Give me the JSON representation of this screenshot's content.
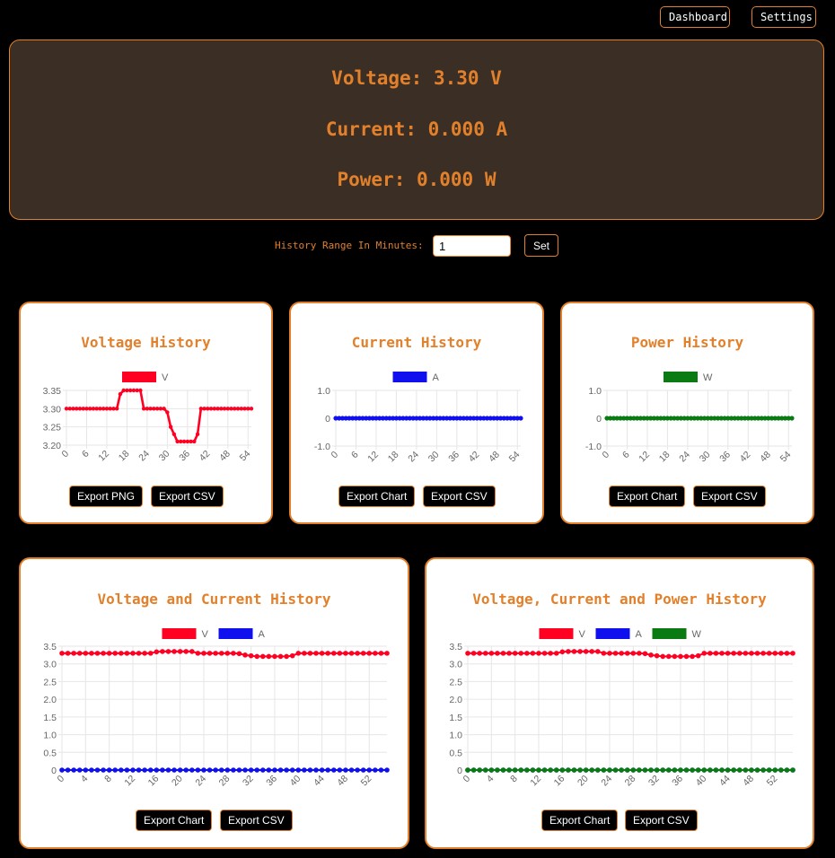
{
  "nav": {
    "dashboard": "Dashboard",
    "settings": "Settings"
  },
  "readout": {
    "voltage": "Voltage: 3.30 V",
    "current": "Current: 0.000 A",
    "power": "Power: 0.000 W"
  },
  "history": {
    "label": "History Range In Minutes:",
    "value": "1",
    "set_label": "Set"
  },
  "colors": {
    "accent": "#e2802b",
    "voltage": "#ff0022",
    "current": "#1010ee",
    "power": "#0a7a12",
    "panel": "#3b2e24"
  },
  "cards": {
    "voltage": {
      "title": "Voltage History",
      "export1": "Export PNG",
      "export2": "Export CSV"
    },
    "current": {
      "title": "Current History",
      "export1": "Export Chart",
      "export2": "Export CSV"
    },
    "power": {
      "title": "Power History",
      "export1": "Export Chart",
      "export2": "Export CSV"
    },
    "vc": {
      "title": "Voltage and Current History",
      "export1": "Export Chart",
      "export2": "Export CSV"
    },
    "vcp": {
      "title": "Voltage, Current and Power History",
      "export1": "Export Chart",
      "export2": "Export CSV"
    }
  },
  "chart_data": [
    {
      "id": "voltage",
      "type": "line",
      "x_ticks": [
        "0",
        "6",
        "12",
        "18",
        "24",
        "30",
        "36",
        "42",
        "48",
        "54"
      ],
      "y_ticks": [
        "3.35",
        "3.30",
        "3.25",
        "3.20"
      ],
      "ylim": [
        3.2,
        3.35
      ],
      "xlim": [
        0,
        55
      ],
      "series": [
        {
          "name": "V",
          "color": "#ff0022",
          "values": [
            3.3,
            3.3,
            3.3,
            3.3,
            3.3,
            3.3,
            3.3,
            3.3,
            3.3,
            3.3,
            3.3,
            3.3,
            3.3,
            3.3,
            3.3,
            3.3,
            3.34,
            3.35,
            3.35,
            3.35,
            3.35,
            3.35,
            3.35,
            3.3,
            3.3,
            3.3,
            3.3,
            3.3,
            3.3,
            3.3,
            3.29,
            3.25,
            3.23,
            3.21,
            3.21,
            3.21,
            3.21,
            3.21,
            3.21,
            3.23,
            3.3,
            3.3,
            3.3,
            3.3,
            3.3,
            3.3,
            3.3,
            3.3,
            3.3,
            3.3,
            3.3,
            3.3,
            3.3,
            3.3,
            3.3,
            3.3
          ]
        }
      ]
    },
    {
      "id": "current",
      "type": "line",
      "x_ticks": [
        "0",
        "6",
        "12",
        "18",
        "24",
        "30",
        "36",
        "42",
        "48",
        "54"
      ],
      "y_ticks": [
        "1.0",
        "0",
        "-1.0"
      ],
      "ylim": [
        -1,
        1
      ],
      "xlim": [
        0,
        55
      ],
      "series": [
        {
          "name": "A",
          "color": "#1010ee",
          "constant": 0,
          "count": 56
        }
      ]
    },
    {
      "id": "power",
      "type": "line",
      "x_ticks": [
        "0",
        "6",
        "12",
        "18",
        "24",
        "30",
        "36",
        "42",
        "48",
        "54"
      ],
      "y_ticks": [
        "1.0",
        "0",
        "-1.0"
      ],
      "ylim": [
        -1,
        1
      ],
      "xlim": [
        0,
        55
      ],
      "series": [
        {
          "name": "W",
          "color": "#0a7a12",
          "constant": 0,
          "count": 56
        }
      ]
    },
    {
      "id": "vc",
      "type": "line",
      "x_ticks": [
        "0",
        "4",
        "8",
        "12",
        "16",
        "20",
        "24",
        "28",
        "32",
        "36",
        "40",
        "44",
        "48",
        "52"
      ],
      "y_ticks": [
        "3.5",
        "3.0",
        "2.5",
        "2.0",
        "1.5",
        "1.0",
        "0.5",
        "0"
      ],
      "ylim": [
        0,
        3.5
      ],
      "xlim": [
        0,
        55
      ],
      "series": [
        {
          "name": "V",
          "color": "#ff0022",
          "ref": "voltage"
        },
        {
          "name": "A",
          "color": "#1010ee",
          "constant": 0,
          "count": 56
        }
      ]
    },
    {
      "id": "vcp",
      "type": "line",
      "x_ticks": [
        "0",
        "4",
        "8",
        "12",
        "16",
        "20",
        "24",
        "28",
        "32",
        "36",
        "40",
        "44",
        "48",
        "52"
      ],
      "y_ticks": [
        "3.5",
        "3.0",
        "2.5",
        "2.0",
        "1.5",
        "1.0",
        "0.5",
        "0"
      ],
      "ylim": [
        0,
        3.5
      ],
      "xlim": [
        0,
        55
      ],
      "series": [
        {
          "name": "V",
          "color": "#ff0022",
          "ref": "voltage"
        },
        {
          "name": "A",
          "color": "#1010ee",
          "constant": 0,
          "count": 56
        },
        {
          "name": "W",
          "color": "#0a7a12",
          "constant": 0,
          "count": 56
        }
      ]
    }
  ]
}
